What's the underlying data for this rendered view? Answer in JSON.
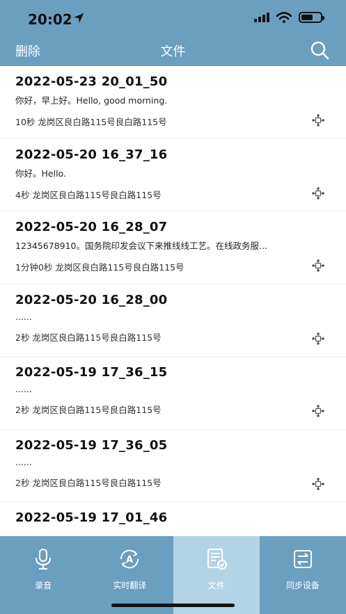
{
  "status": {
    "time": "20:02"
  },
  "nav": {
    "delete_label": "删除",
    "title": "文件",
    "search_icon": "search-icon"
  },
  "files": [
    {
      "title": "2022-05-23 20_01_50",
      "text": "你好，早上好。Hello, good morning.",
      "meta": "10秒  龙岗区良白路115号良白路115号"
    },
    {
      "title": "2022-05-20 16_37_16",
      "text": "你好。Hello.",
      "meta": "4秒  龙岗区良白路115号良白路115号"
    },
    {
      "title": "2022-05-20 16_28_07",
      "text": "12345678910。国务院印发会议下来推线线工艺。在线政务服...",
      "meta": "1分钟0秒  龙岗区良白路115号良白路115号"
    },
    {
      "title": "2022-05-20 16_28_00",
      "text": "......",
      "meta": "2秒  龙岗区良白路115号良白路115号"
    },
    {
      "title": "2022-05-19 17_36_15",
      "text": "......",
      "meta": "2秒  龙岗区良白路115号良白路115号"
    },
    {
      "title": "2022-05-19 17_36_05",
      "text": "......",
      "meta": "2秒  龙岗区良白路115号良白路115号"
    },
    {
      "title": "2022-05-19 17_01_46",
      "text": "",
      "meta": ""
    }
  ],
  "tabs": [
    {
      "label": "录音",
      "icon": "microphone-icon",
      "active": false
    },
    {
      "label": "实时翻译",
      "icon": "translate-icon",
      "active": false
    },
    {
      "label": "文件",
      "icon": "file-list-icon",
      "active": true
    },
    {
      "label": "同步设备",
      "icon": "sync-icon",
      "active": false
    }
  ],
  "colors": {
    "primary": "#6a9fc0",
    "active_tab": "#b3d4e6"
  }
}
